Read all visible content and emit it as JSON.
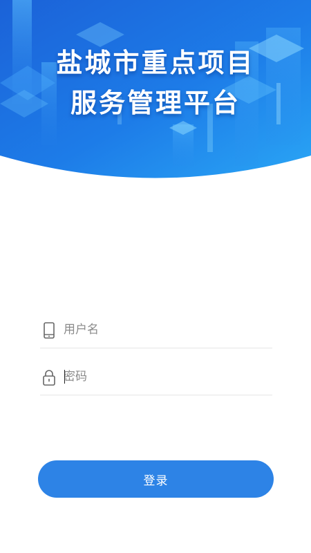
{
  "header": {
    "title_line1": "盐城市重点项目",
    "title_line2": "服务管理平台"
  },
  "form": {
    "username": {
      "placeholder": "用户名",
      "value": "",
      "icon": "phone-icon"
    },
    "password": {
      "placeholder": "密码",
      "value": "",
      "icon": "lock-icon"
    }
  },
  "login_button": {
    "label": "登录"
  },
  "colors": {
    "primary": "#2d83e6",
    "header_gradient_start": "#1a6de0",
    "header_gradient_end": "#27a0f4"
  }
}
